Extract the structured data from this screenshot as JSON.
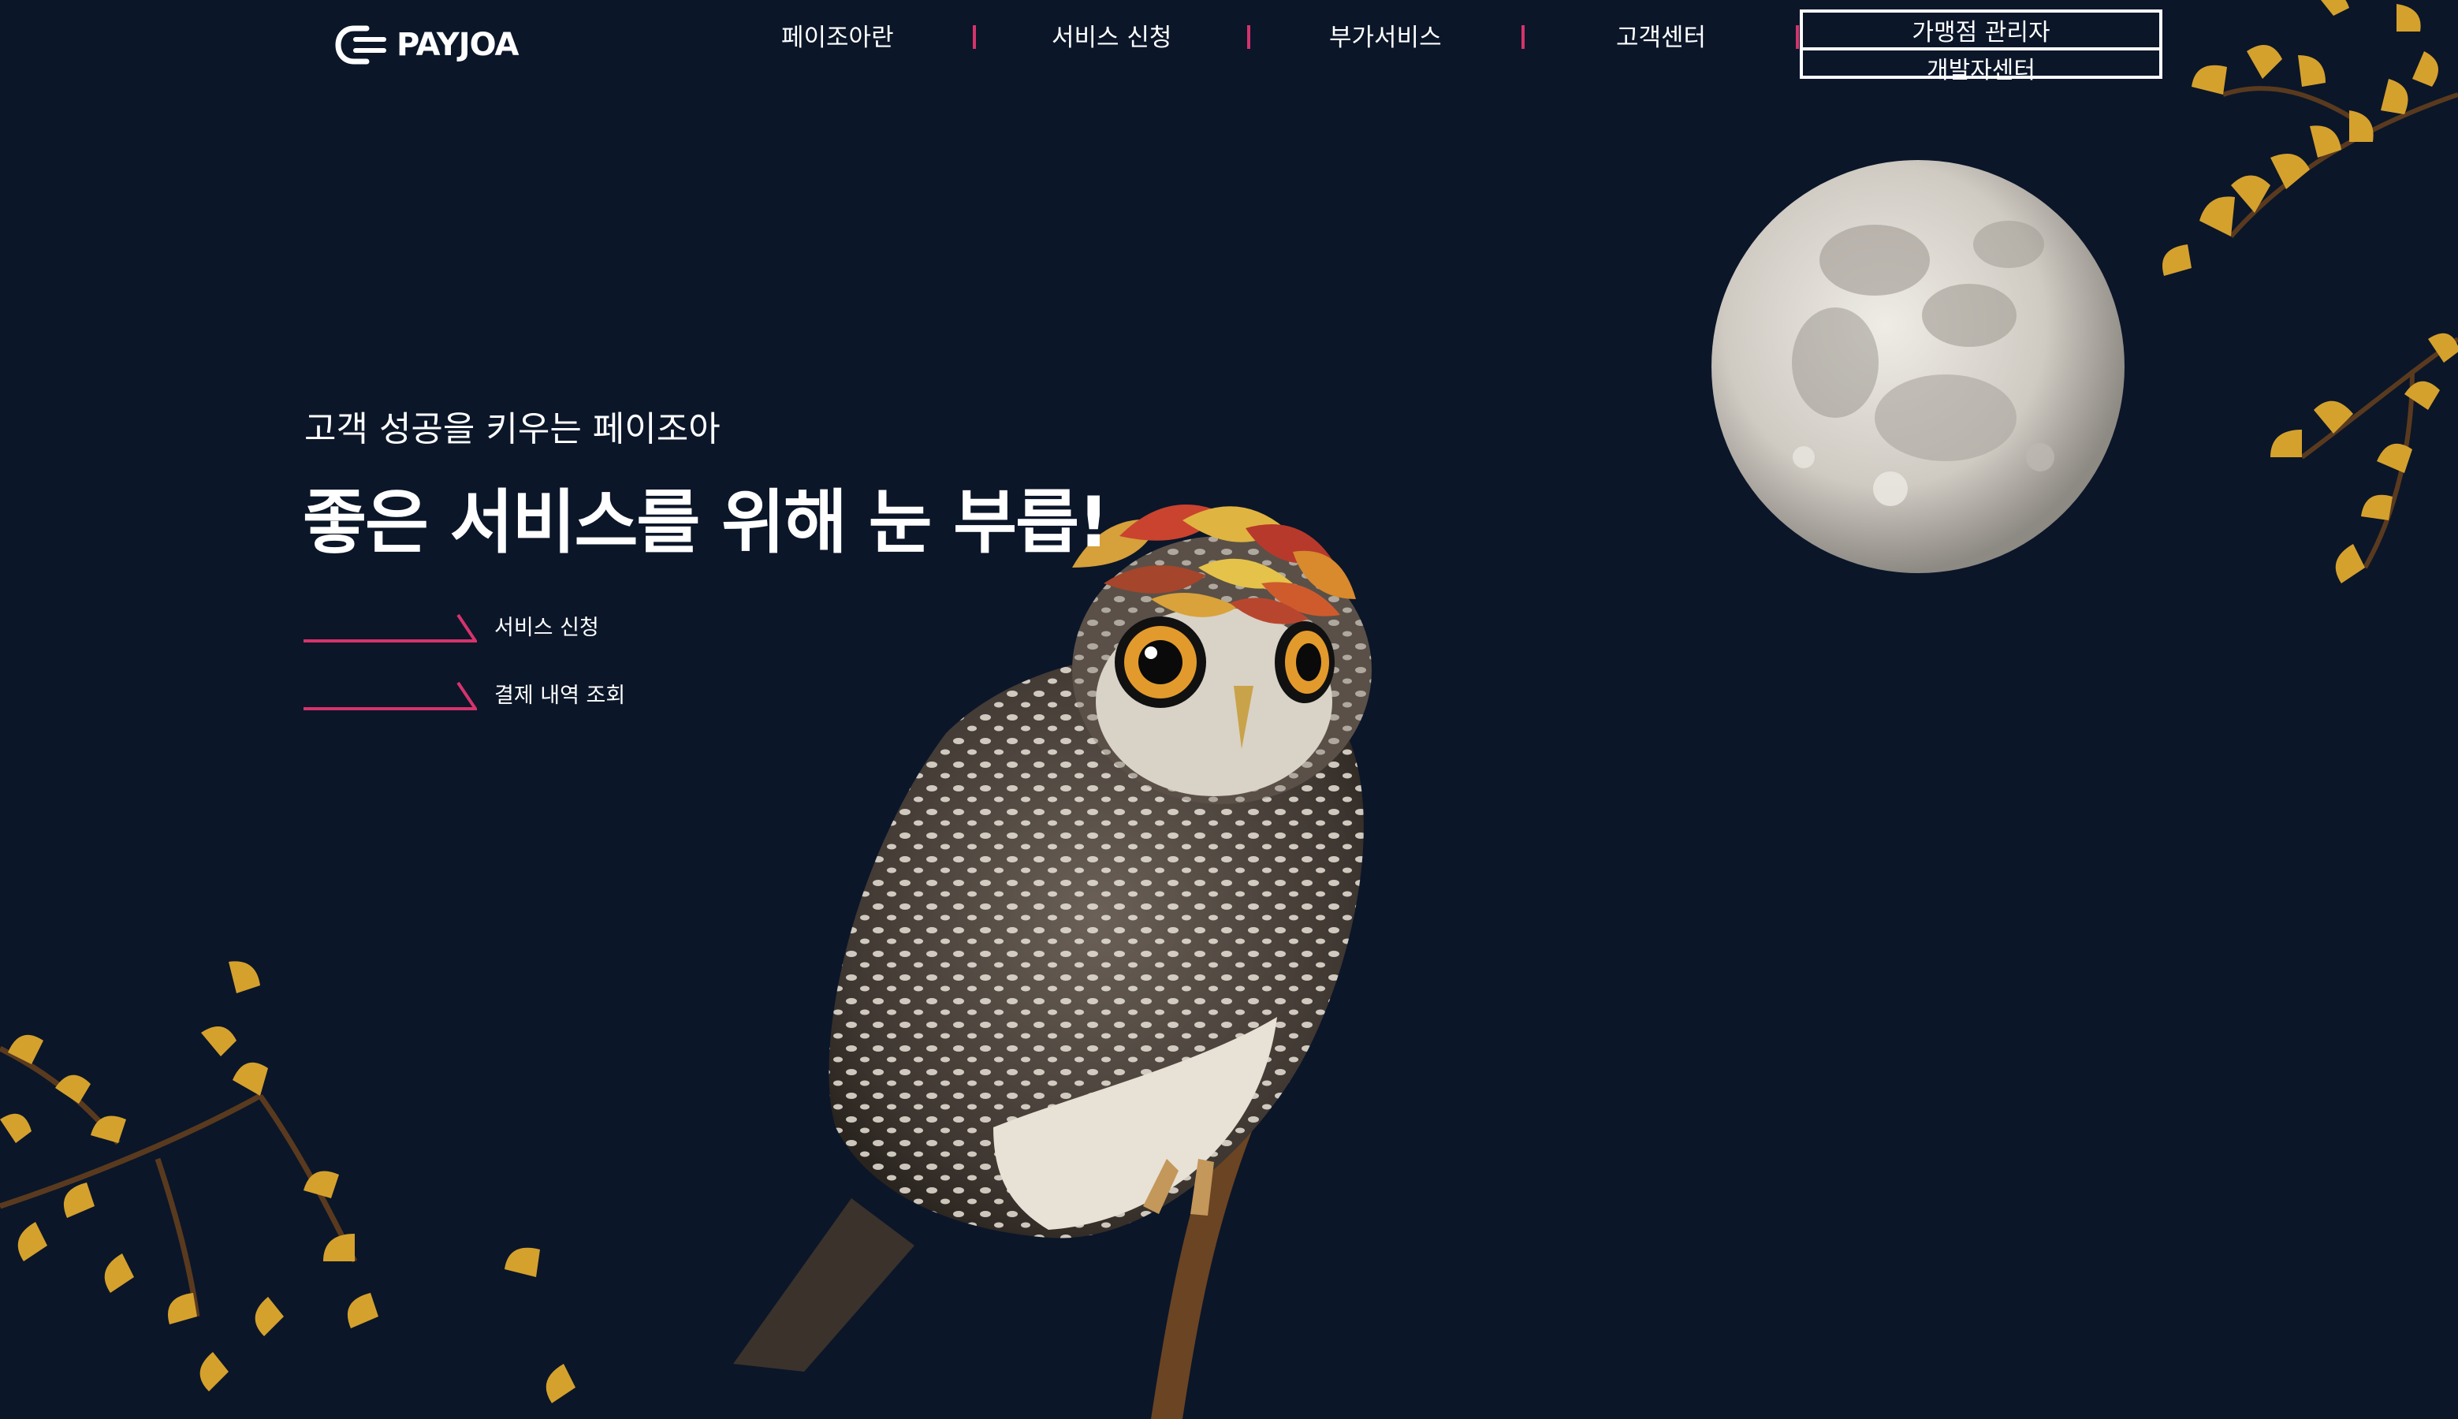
{
  "brand": {
    "name": "PAYJOA",
    "logo_icon": "payjoa-logo-icon",
    "accent_color": "#d6336c",
    "background_color": "#0b1629"
  },
  "nav": {
    "items": [
      {
        "label": "페이조아란"
      },
      {
        "label": "서비스 신청"
      },
      {
        "label": "부가서비스"
      },
      {
        "label": "고객센터"
      }
    ]
  },
  "admin_links": {
    "merchant_admin": "가맹점 관리자",
    "developer_center": "개발자센터"
  },
  "hero": {
    "subtitle": "고객 성공을 키우는 페이조아",
    "title": "좋은 서비스를 위해 눈 부릅!",
    "ctas": [
      {
        "label": "서비스 신청",
        "icon": "arrow-line-icon"
      },
      {
        "label": "결제 내역 조회",
        "icon": "arrow-line-icon"
      }
    ]
  },
  "illustrations": {
    "moon": "full-moon-image",
    "owl": "owl-with-autumn-leaves-image",
    "branches": "ginkgo-branch-image"
  }
}
